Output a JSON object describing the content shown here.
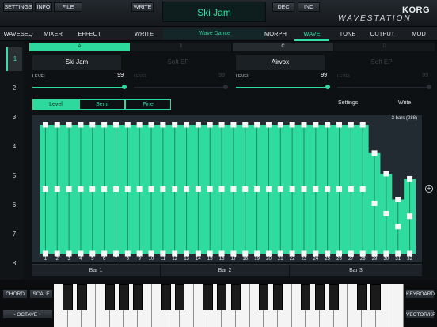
{
  "topbar": {
    "settings": "SETTINGS",
    "info": "INFO",
    "file": "FILE",
    "write": "WRITE",
    "title": "Ski Jam",
    "dec": "DEC",
    "inc": "INC",
    "brand": "KORG",
    "product": "WAVESTATION"
  },
  "menu": {
    "waveseq": "WAVESEQ",
    "mixer": "MIXER",
    "effect": "EFFECT",
    "write": "WRITE",
    "field": "Wave Dance",
    "morph": "MORPH",
    "wave": "WAVE",
    "tone": "TONE",
    "output": "OUTPUT",
    "mod": "MOD"
  },
  "sidebar": [
    "1",
    "2",
    "3",
    "4",
    "5",
    "6",
    "7",
    "8"
  ],
  "slots": [
    {
      "letter": "A",
      "name": "Ski Jam",
      "level_label": "LEVEL",
      "level": "99",
      "active": true
    },
    {
      "letter": "B",
      "name": "Soft EP",
      "level_label": "LEVEL",
      "level": "99",
      "active": false
    },
    {
      "letter": "C",
      "name": "Airvox",
      "level_label": "LEVEL",
      "level": "99",
      "active": true
    },
    {
      "letter": "D",
      "name": "Soft EP",
      "level_label": "LEVEL",
      "level": "99",
      "active": false
    }
  ],
  "segments": {
    "level": "Level",
    "semi": "Semi",
    "fine": "Fine"
  },
  "actions": {
    "settings": "Settings",
    "write": "Write"
  },
  "graph_note": "3 bars (288)",
  "step_labels": [
    "1",
    "2",
    "3",
    "4",
    "5",
    "6",
    "7",
    "8",
    "9",
    "10",
    "11",
    "12",
    "13",
    "14",
    "15",
    "16",
    "17",
    "18",
    "19",
    "20",
    "21",
    "22",
    "23",
    "24",
    "25",
    "26",
    "27",
    "28",
    "29",
    "30",
    "31",
    "32"
  ],
  "bars": [
    "Bar 1",
    "Bar 2",
    "Bar 3"
  ],
  "keyboard": {
    "chord": "CHORD",
    "scale": "SCALE",
    "octave": "- OCTAVE +",
    "keyboard": "KEYBOARD",
    "vector": "VECTOR/KP"
  },
  "colors": {
    "accent": "#2dd99c",
    "bg": "#0e1114"
  }
}
